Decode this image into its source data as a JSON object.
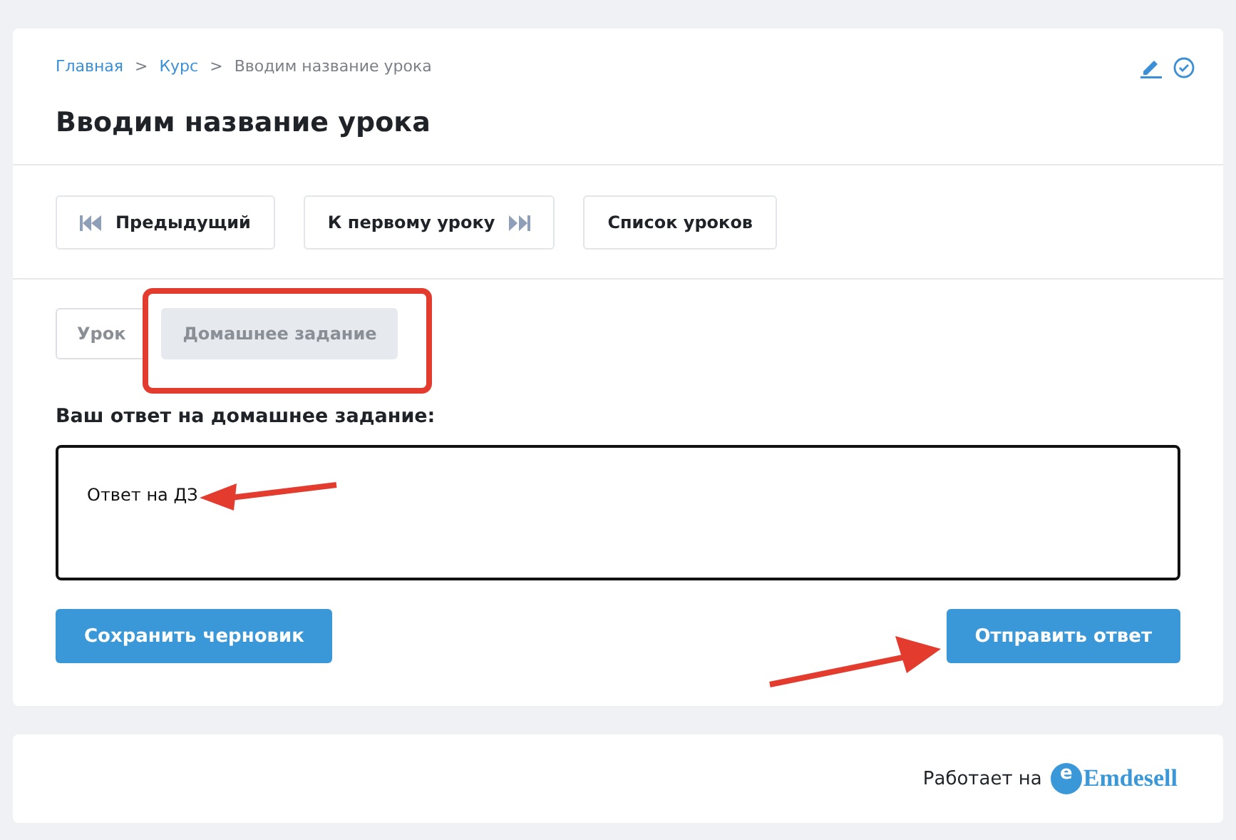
{
  "breadcrumbs": [
    {
      "label": "Главная",
      "link": true
    },
    {
      "label": "Курс",
      "link": true
    },
    {
      "label": "Вводим название урока",
      "link": false
    }
  ],
  "breadcrumb_separator": ">",
  "title": "Вводим название урока",
  "nav_buttons": [
    {
      "label": "Предыдущий",
      "kind": "prev"
    },
    {
      "label": "К первому уроку",
      "kind": "next"
    },
    {
      "label": "Список уроков",
      "kind": "plain"
    }
  ],
  "tabs": [
    {
      "label": "Урок",
      "selected": false
    },
    {
      "label": "Домашнее задание",
      "selected": true
    }
  ],
  "answer": {
    "label": "Ваш ответ на домашнее задание:",
    "value": "Ответ на ДЗ"
  },
  "actions": [
    {
      "label": "Сохранить черновик"
    },
    {
      "label": "Отправить ответ"
    }
  ],
  "footer": {
    "text": "Работает на",
    "logo_mark": "e",
    "logo_text": "Emdesell"
  }
}
